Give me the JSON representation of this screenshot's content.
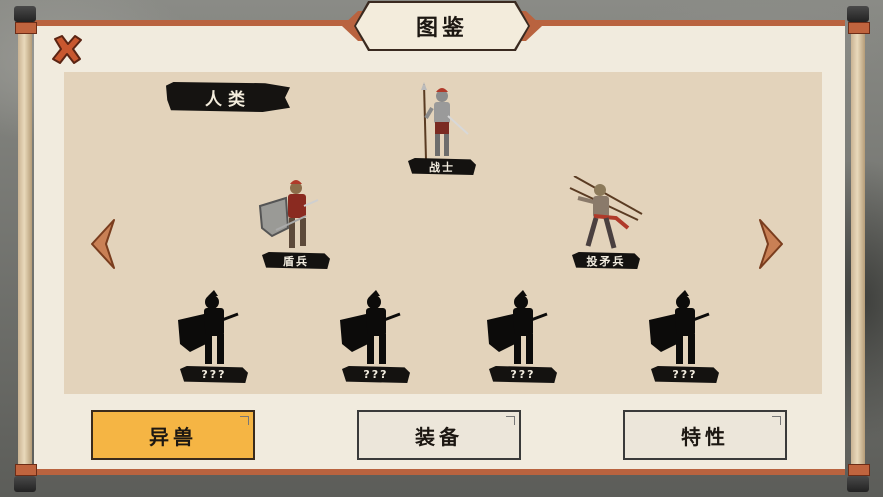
{
  "header": {
    "title": "图鉴"
  },
  "category": {
    "label": "人类"
  },
  "units": [
    {
      "name": "战士",
      "unlocked": true,
      "icon": "spearman-warrior-icon"
    },
    {
      "name": "盾兵",
      "unlocked": true,
      "icon": "shield-soldier-icon"
    },
    {
      "name": "投矛兵",
      "unlocked": true,
      "icon": "javelin-thrower-icon"
    },
    {
      "name": "???",
      "unlocked": false,
      "icon": "locked-silhouette-icon"
    },
    {
      "name": "???",
      "unlocked": false,
      "icon": "locked-silhouette-icon"
    },
    {
      "name": "???",
      "unlocked": false,
      "icon": "locked-silhouette-icon"
    },
    {
      "name": "???",
      "unlocked": false,
      "icon": "locked-silhouette-icon"
    }
  ],
  "tabs": [
    {
      "label": "异兽",
      "active": true
    },
    {
      "label": "装备",
      "active": false
    },
    {
      "label": "特性",
      "active": false
    }
  ],
  "icons": {
    "close": "close-x-icon",
    "prev": "chevron-left-icon",
    "next": "chevron-right-icon"
  },
  "colors": {
    "accent": "#b9633f",
    "active_tab": "#f5b544",
    "paper": "#f1ebde",
    "panel": "#e3d3bb"
  }
}
